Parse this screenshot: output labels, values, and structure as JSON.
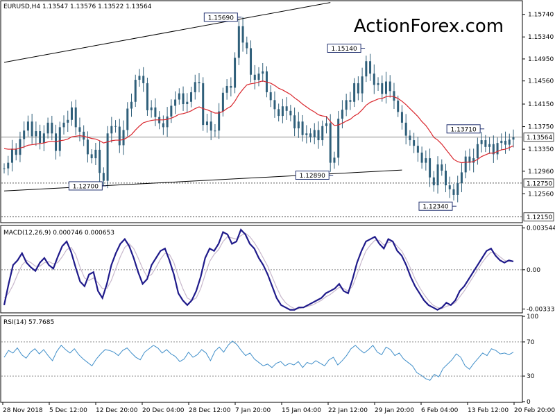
{
  "colors": {
    "background": "#ffffff",
    "candles": "#2f5f7a",
    "ma": "#d9262c",
    "trendline": "#000000",
    "macd_line": "#1f1a8a",
    "macd_signal": "#c8b8cc",
    "rsi_line": "#3f8ec9",
    "dotted": "#8a8a8a",
    "watermark": "#c9c9c9",
    "label_border": "#1f2f6e"
  },
  "chart_data": {
    "type": "candlestick",
    "title": "EURUSD,H4  1.13547 1.13576 1.13522 1.13564",
    "watermark": "ActionForex.com",
    "ylim": [
      1.1206,
      1.1597
    ],
    "y_ticks": [
      "1.15740",
      "1.15340",
      "1.14950",
      "1.14560",
      "1.14150",
      "1.13750",
      "1.13350",
      "1.12960",
      "1.12560"
    ],
    "current_price_label": "1.13564",
    "support_label": "1.12750",
    "bottom_label": "1.12150",
    "x_tick_labels": [
      "28 Nov 2018",
      "5 Dec 12:00",
      "12 Dec 20:00",
      "20 Dec 04:00",
      "28 Dec 12:00",
      "7 Jan 20:00",
      "15 Jan 04:00",
      "22 Jan 12:00",
      "29 Jan 20:00",
      "6 Feb 04:00",
      "13 Feb 12:00",
      "20 Feb 20:00"
    ],
    "pivot_labels": [
      {
        "text": "1.15690",
        "bar": 59,
        "price": 1.1569,
        "side": "left"
      },
      {
        "text": "1.15140",
        "bar": 90,
        "price": 1.1514,
        "side": "left"
      },
      {
        "text": "1.13710",
        "bar": 120,
        "price": 1.1371,
        "side": "left"
      },
      {
        "text": "1.12700",
        "bar": 25,
        "price": 1.127,
        "side": "left"
      },
      {
        "text": "1.12890",
        "bar": 82,
        "price": 1.1289,
        "side": "left"
      },
      {
        "text": "1.12340",
        "bar": 113,
        "price": 1.1234,
        "side": "left"
      }
    ],
    "trendlines": [
      {
        "x1": 0,
        "y1": 1.1489,
        "x2": 82,
        "y2": 1.1595
      },
      {
        "x1": 0,
        "y1": 1.1261,
        "x2": 100,
        "y2": 1.1298
      }
    ],
    "close_series": [
      1.1301,
      1.1311,
      1.1336,
      1.1325,
      1.1353,
      1.1368,
      1.1384,
      1.1358,
      1.1367,
      1.1346,
      1.1363,
      1.1382,
      1.1363,
      1.1332,
      1.1374,
      1.1382,
      1.1387,
      1.1409,
      1.1374,
      1.1366,
      1.1352,
      1.1326,
      1.1319,
      1.1334,
      1.1293,
      1.1279,
      1.1363,
      1.1376,
      1.1375,
      1.1342,
      1.1369,
      1.1407,
      1.1419,
      1.1458,
      1.1465,
      1.1452,
      1.1404,
      1.1409,
      1.1392,
      1.1381,
      1.1374,
      1.1393,
      1.1412,
      1.1423,
      1.1434,
      1.1415,
      1.1419,
      1.1436,
      1.1454,
      1.1452,
      1.1378,
      1.1384,
      1.1368,
      1.1368,
      1.1402,
      1.1435,
      1.1447,
      1.1444,
      1.1497,
      1.1553,
      1.1524,
      1.1514,
      1.1467,
      1.1458,
      1.1469,
      1.1473,
      1.1436,
      1.1422,
      1.1406,
      1.1394,
      1.1411,
      1.1403,
      1.1395,
      1.1372,
      1.1384,
      1.136,
      1.1363,
      1.1356,
      1.1369,
      1.1351,
      1.1376,
      1.1381,
      1.1311,
      1.132,
      1.1389,
      1.1405,
      1.1422,
      1.1419,
      1.1452,
      1.1434,
      1.1464,
      1.1491,
      1.1469,
      1.1449,
      1.1452,
      1.1433,
      1.1455,
      1.1438,
      1.1421,
      1.1401,
      1.1382,
      1.1359,
      1.1351,
      1.1341,
      1.1329,
      1.1311,
      1.1319,
      1.1285,
      1.1271,
      1.1308,
      1.1297,
      1.1271,
      1.1264,
      1.1254,
      1.1275,
      1.1294,
      1.1322,
      1.1311,
      1.1319,
      1.1344,
      1.1351,
      1.1339,
      1.1344,
      1.1326,
      1.1346,
      1.135,
      1.1343,
      1.1352,
      1.1356
    ],
    "ma_series": [
      1.1336,
      1.1335,
      1.1335,
      1.1335,
      1.1337,
      1.1339,
      1.1342,
      1.1343,
      1.1344,
      1.1345,
      1.1346,
      1.1348,
      1.1349,
      1.1348,
      1.135,
      1.1351,
      1.1353,
      1.1357,
      1.1358,
      1.1359,
      1.1358,
      1.1356,
      1.1354,
      1.1353,
      1.135,
      1.1346,
      1.1348,
      1.135,
      1.1351,
      1.1351,
      1.1352,
      1.1356,
      1.1361,
      1.1369,
      1.1376,
      1.1382,
      1.1384,
      1.1386,
      1.1387,
      1.1387,
      1.1387,
      1.1388,
      1.139,
      1.1393,
      1.1397,
      1.1398,
      1.14,
      1.1403,
      1.1407,
      1.141,
      1.1407,
      1.1405,
      1.1402,
      1.1399,
      1.1399,
      1.1402,
      1.1407,
      1.1411,
      1.142,
      1.1432,
      1.1441,
      1.1449,
      1.1451,
      1.1452,
      1.1454,
      1.1456,
      1.1454,
      1.1452,
      1.1448,
      1.1443,
      1.144,
      1.1436,
      1.1432,
      1.1426,
      1.1421,
      1.1415,
      1.141,
      1.1405,
      1.1401,
      1.1396,
      1.1394,
      1.1393,
      1.1384,
      1.1377,
      1.1378,
      1.1381,
      1.1385,
      1.1388,
      1.1394,
      1.1398,
      1.1405,
      1.1413,
      1.1418,
      1.1421,
      1.1424,
      1.1425,
      1.1428,
      1.1429,
      1.1428,
      1.1425,
      1.142,
      1.1414,
      1.1407,
      1.14,
      1.1393,
      1.1384,
      1.1377,
      1.1367,
      1.1356,
      1.1351,
      1.1344,
      1.1335,
      1.1326,
      1.1317,
      1.1313,
      1.1311,
      1.1312,
      1.1312,
      1.1313,
      1.1317,
      1.1322,
      1.1325,
      1.1328,
      1.1328,
      1.1331,
      1.1334,
      1.1335,
      1.1338,
      1.1341
    ],
    "macd": {
      "label": "MACD(12,26,9) 0.000746 0.000653",
      "ylim": [
        -0.0036,
        0.0037
      ],
      "y_ticks": [
        "0.003544",
        "0.00",
        "-0.003331"
      ],
      "line": [
        -0.003,
        -0.0012,
        0.0004,
        0.0008,
        0.0014,
        0.0006,
        0.0002,
        -0.0001,
        0.0006,
        0.001,
        0.0004,
        0.0001,
        0.0011,
        0.002,
        0.0024,
        0.0015,
        0.0002,
        -0.001,
        -0.0014,
        -0.0004,
        -0.0002,
        -0.0018,
        -0.0024,
        -0.0012,
        0.0004,
        0.0014,
        0.0022,
        0.0026,
        0.002,
        0.001,
        -0.0002,
        -0.0012,
        -0.0008,
        0.0004,
        0.001,
        0.0016,
        0.0018,
        0.0008,
        -0.0004,
        -0.002,
        -0.0026,
        -0.003,
        -0.0026,
        -0.0018,
        -0.0006,
        0.001,
        0.0018,
        0.0016,
        0.0022,
        0.0032,
        0.003,
        0.0022,
        0.0024,
        0.0034,
        0.003,
        0.0022,
        0.0018,
        0.001,
        0.0004,
        -0.0004,
        -0.0014,
        -0.0024,
        -0.003,
        -0.0032,
        -0.0034,
        -0.0034,
        -0.0032,
        -0.0032,
        -0.003,
        -0.0028,
        -0.0026,
        -0.0024,
        -0.002,
        -0.0018,
        -0.0016,
        -0.0012,
        -0.0018,
        -0.002,
        -0.0008,
        0.0006,
        0.0016,
        0.0024,
        0.0026,
        0.0028,
        0.0022,
        0.0018,
        0.0026,
        0.0024,
        0.0016,
        0.0012,
        0.0004,
        -0.0006,
        -0.0014,
        -0.002,
        -0.0026,
        -0.003,
        -0.0032,
        -0.0034,
        -0.0032,
        -0.0028,
        -0.003,
        -0.0026,
        -0.0018,
        -0.0014,
        -0.0008,
        -0.0002,
        0.0004,
        0.001,
        0.0016,
        0.0018,
        0.0012,
        0.0008,
        0.0006,
        0.0008,
        0.0007
      ],
      "signal": [
        -0.0024,
        -0.002,
        -0.0013,
        -0.0004,
        0.0004,
        0.0008,
        0.0006,
        0.0003,
        0.0003,
        0.0006,
        0.0007,
        0.0005,
        0.0006,
        0.0011,
        0.0017,
        0.0019,
        0.0013,
        0.0002,
        -0.0007,
        -0.0009,
        -0.0007,
        -0.0011,
        -0.0016,
        -0.0016,
        -0.0009,
        0.0001,
        0.0011,
        0.0019,
        0.0022,
        0.0018,
        0.001,
        0.0001,
        -0.0006,
        -0.0004,
        0.0002,
        0.0009,
        0.0014,
        0.0013,
        0.0006,
        -0.0006,
        -0.0016,
        -0.0024,
        -0.0026,
        -0.0024,
        -0.0016,
        -0.0004,
        0.0007,
        0.0013,
        0.0017,
        0.0024,
        0.0028,
        0.0027,
        0.0026,
        0.0029,
        0.0031,
        0.0028,
        0.0023,
        0.0017,
        0.001,
        0.0003,
        -0.0006,
        -0.0015,
        -0.0023,
        -0.0028,
        -0.0031,
        -0.0033,
        -0.0033,
        -0.0032,
        -0.0031,
        -0.003,
        -0.0028,
        -0.0026,
        -0.0023,
        -0.0021,
        -0.0018,
        -0.0015,
        -0.0016,
        -0.0018,
        -0.0014,
        -0.0004,
        0.0007,
        0.0016,
        0.0021,
        0.0025,
        0.0025,
        0.0021,
        0.0023,
        0.0024,
        0.002,
        0.0016,
        0.0009,
        0.0001,
        -0.0008,
        -0.0015,
        -0.0021,
        -0.0026,
        -0.003,
        -0.0032,
        -0.0033,
        -0.0031,
        -0.003,
        -0.0028,
        -0.0023,
        -0.0018,
        -0.0012,
        -0.0006,
        0.0,
        0.0006,
        0.0011,
        0.0015,
        0.0014,
        0.0011,
        0.0008,
        0.0007,
        0.0007
      ]
    },
    "rsi": {
      "label": "RSI(14) 57.7685",
      "ylim": [
        0,
        100
      ],
      "y_ticks": [
        "100",
        "70",
        "30",
        "0"
      ],
      "levels": [
        70,
        30
      ],
      "values": [
        52,
        60,
        57,
        63,
        55,
        51,
        58,
        62,
        56,
        61,
        54,
        48,
        59,
        66,
        61,
        57,
        62,
        55,
        50,
        46,
        42,
        50,
        56,
        61,
        60,
        58,
        54,
        60,
        63,
        57,
        52,
        49,
        58,
        62,
        66,
        63,
        57,
        61,
        56,
        53,
        47,
        50,
        58,
        52,
        55,
        61,
        57,
        48,
        59,
        64,
        58,
        66,
        71,
        67,
        60,
        54,
        57,
        50,
        46,
        42,
        44,
        40,
        45,
        47,
        42,
        45,
        43,
        47,
        40,
        46,
        44,
        48,
        45,
        42,
        49,
        52,
        43,
        48,
        54,
        62,
        66,
        61,
        57,
        61,
        66,
        58,
        55,
        64,
        61,
        54,
        57,
        50,
        46,
        42,
        34,
        31,
        27,
        25,
        32,
        29,
        39,
        44,
        49,
        56,
        52,
        42,
        38,
        45,
        51,
        57,
        54,
        62,
        60,
        56,
        57,
        55,
        58
      ]
    }
  }
}
